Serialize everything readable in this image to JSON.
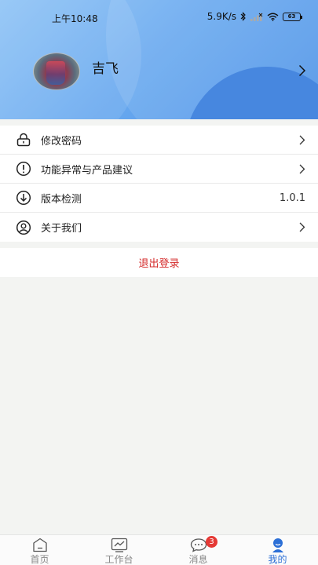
{
  "status_bar": {
    "time": "上午10:48",
    "net_speed": "5.9K/s",
    "battery": "63"
  },
  "profile": {
    "username": "吉飞"
  },
  "menu": {
    "items": [
      {
        "label": "修改密码",
        "icon": "lock-icon",
        "has_chevron": true
      },
      {
        "label": "功能异常与产品建议",
        "icon": "exclamation-circle-icon",
        "has_chevron": true
      },
      {
        "label": "版本检测",
        "icon": "download-circle-icon",
        "value": "1.0.1"
      },
      {
        "label": "关于我们",
        "icon": "user-circle-icon",
        "has_chevron": true
      }
    ]
  },
  "logout_label": "退出登录",
  "tabbar": {
    "tabs": [
      {
        "label": "首页",
        "icon": "home-icon"
      },
      {
        "label": "工作台",
        "icon": "workbench-chart-icon"
      },
      {
        "label": "消息",
        "icon": "message-icon",
        "badge": "3"
      },
      {
        "label": "我的",
        "icon": "profile-icon",
        "active": true
      }
    ]
  },
  "colors": {
    "header_start": "#8ec3f5",
    "header_end": "#4d92e6",
    "logout_red": "#d42a2a",
    "active_tab": "#2c6fd6",
    "badge_red": "#e53935"
  }
}
